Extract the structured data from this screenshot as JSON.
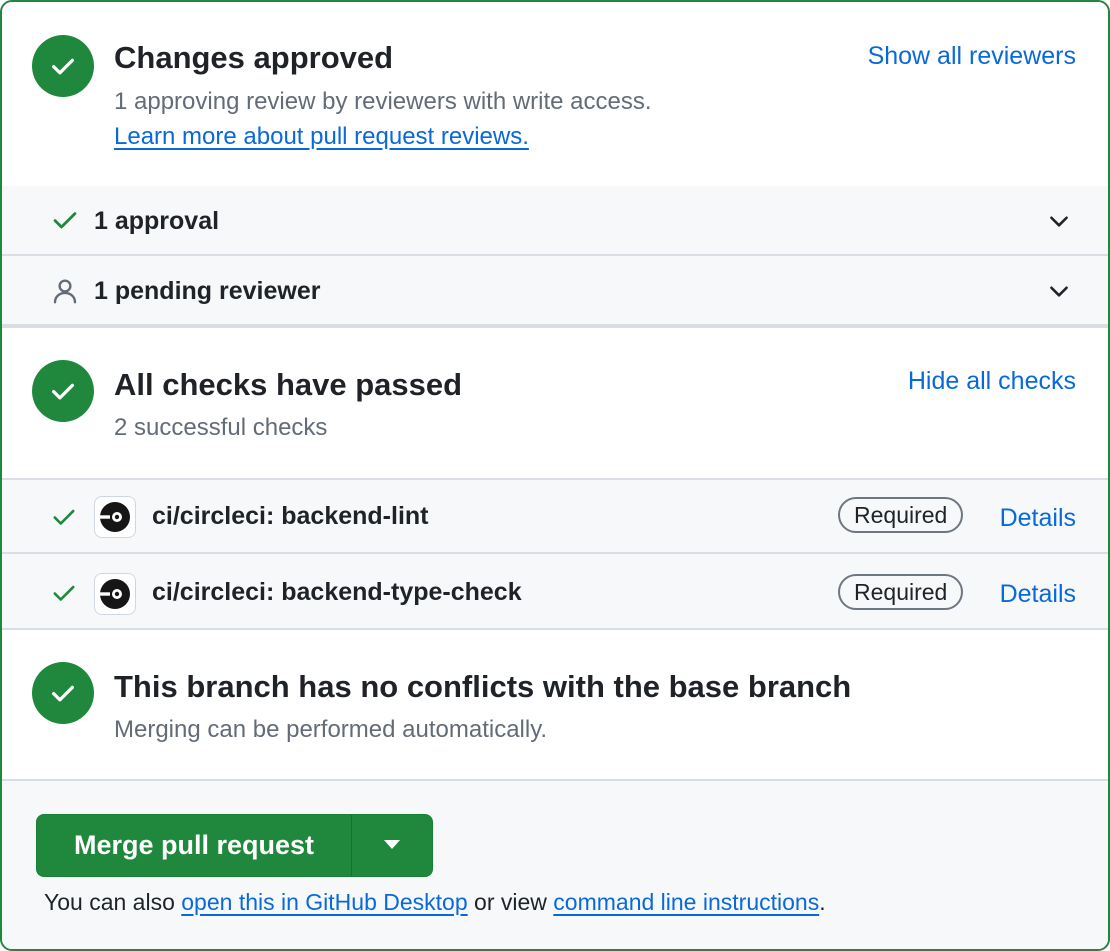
{
  "colors": {
    "success": "#1f883d",
    "link": "#0969da",
    "muted": "#636c76",
    "row_background": "#f6f8fa"
  },
  "review": {
    "title": "Changes approved",
    "subtitle": "1 approving review by reviewers with write access.",
    "learn_more": "Learn more about pull request reviews.",
    "show_all": "Show all reviewers",
    "status_icon": "check-circle-icon",
    "rows": [
      {
        "icon": "check-icon",
        "label": "1 approval"
      },
      {
        "icon": "person-icon",
        "label": "1 pending reviewer"
      }
    ]
  },
  "checks": {
    "title": "All checks have passed",
    "subtitle": "2 successful checks",
    "hide_all": "Hide all checks",
    "status_icon": "check-circle-icon",
    "items": [
      {
        "name": "ci/circleci: backend-lint",
        "badge": "Required",
        "details": "Details",
        "icon": "circleci-icon"
      },
      {
        "name": "ci/circleci: backend-type-check",
        "badge": "Required",
        "details": "Details",
        "icon": "circleci-icon"
      }
    ]
  },
  "conflicts": {
    "title": "This branch has no conflicts with the base branch",
    "subtitle": "Merging can be performed automatically.",
    "status_icon": "check-circle-icon"
  },
  "merge": {
    "button_label": "Merge pull request",
    "dropdown_icon": "triangle-down-icon",
    "note_prefix": "You can also",
    "desktop_link": "open this in GitHub Desktop",
    "note_middle": "or view",
    "cli_link": "command line instructions",
    "note_suffix": "."
  }
}
